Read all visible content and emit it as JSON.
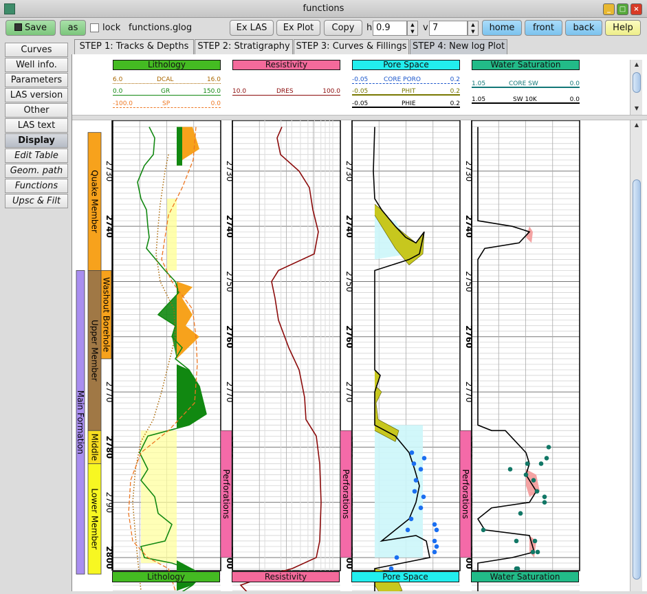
{
  "window": {
    "title": "functions"
  },
  "toolbar": {
    "save": "Save",
    "as": "as",
    "lock": "lock",
    "filename": "functions.glog",
    "ex_las": "Ex LAS",
    "ex_plot": "Ex Plot",
    "copy": "Copy",
    "h_label": "h",
    "h_value": "0.9",
    "v_label": "v",
    "v_value": "7",
    "home": "home",
    "front": "front",
    "back": "back",
    "help": "Help"
  },
  "sidebar": {
    "items": [
      {
        "label": "Curves"
      },
      {
        "label": "Well info."
      },
      {
        "label": "Parameters"
      },
      {
        "label": "LAS version"
      },
      {
        "label": "Other"
      },
      {
        "label": "LAS text"
      },
      {
        "label": "Display"
      },
      {
        "label": "Edit Table"
      },
      {
        "label": "Geom. path"
      },
      {
        "label": "Functions"
      },
      {
        "label": "Upsc & Filt"
      }
    ]
  },
  "tabs": [
    {
      "label": "STEP 1: Tracks & Depths"
    },
    {
      "label": "STEP 2: Stratigraphy"
    },
    {
      "label": "STEP 3: Curves & Fillings"
    },
    {
      "label": "STEP 4: New log Plot"
    }
  ],
  "tracks": {
    "lithology": {
      "title": "Lithology",
      "curves": [
        {
          "min": "6.0",
          "name": "DCAL",
          "max": "16.0"
        },
        {
          "min": "0.0",
          "name": "GR",
          "max": "150.0"
        },
        {
          "min": "-100.0",
          "name": "SP",
          "max": "0.0"
        }
      ]
    },
    "resistivity": {
      "title": "Resistivity",
      "curves": [
        {
          "min": "10.0",
          "name": "DRES",
          "max": "100.0"
        }
      ]
    },
    "pore": {
      "title": "Pore Space",
      "curves": [
        {
          "min": "-0.05",
          "name": "CORE PORO",
          "max": "0.2"
        },
        {
          "min": "-0.05",
          "name": "PHIT",
          "max": "0.2"
        },
        {
          "min": "-0.05",
          "name": "PHIE",
          "max": "0.2"
        }
      ]
    },
    "sw": {
      "title": "Water Saturation",
      "curves": [
        {
          "min": "1.05",
          "name": "CORE SW",
          "max": "0.0"
        },
        {
          "min": "1.05",
          "name": "SW 10K",
          "max": "0.0"
        }
      ]
    }
  },
  "depths": [
    "2730",
    "2740",
    "2750",
    "2760",
    "2770",
    "2780",
    "2790",
    "2800"
  ],
  "strat": {
    "main": "Main Formation",
    "quake": "Quake Member",
    "upper": "Upper Member",
    "middle": "Middle",
    "lower": "Lower Member",
    "washout": "Washout Borehole",
    "perf": "Perforations"
  },
  "colors": {
    "litho": "#44bb22",
    "resist": "#f46a9b",
    "pore": "#22eeee",
    "sw": "#22bb88",
    "gr": "#118811",
    "dcal": "#aa6600",
    "sp": "#ee7722",
    "dres": "#8b0a0a",
    "quake": "#f7a21c",
    "upper": "#a07845",
    "middle": "#f7dd22",
    "lower": "#f7f722",
    "main": "#a98ef0",
    "perf": "#f46aa8"
  }
}
